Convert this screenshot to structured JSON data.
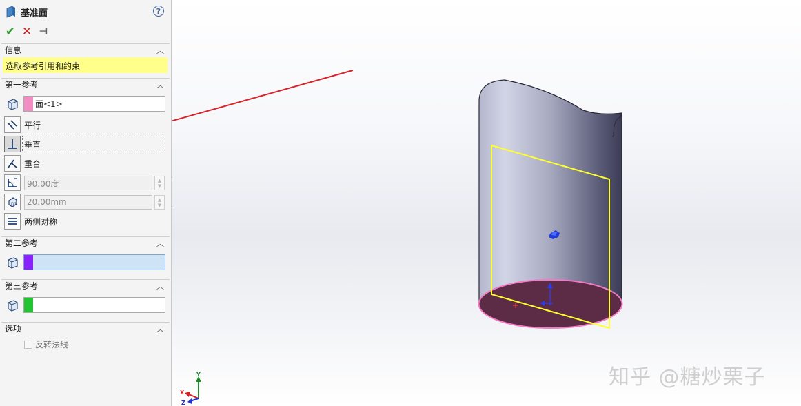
{
  "panel": {
    "title": "基准面",
    "help_glyph": "?",
    "actions": {
      "ok": "✔",
      "cancel": "✕",
      "pin": "⊣"
    },
    "info": {
      "header": "信息",
      "message": "选取参考引用和约束"
    },
    "first_ref": {
      "header": "第一参考",
      "selection": "面<1>",
      "swatch_color": "#f48cc4",
      "constraints": {
        "parallel": "平行",
        "perpendicular": "垂直",
        "coincident": "重合",
        "angle_value": "90.00度",
        "distance_value": "20.00mm",
        "symmetric": "两侧对称"
      }
    },
    "second_ref": {
      "header": "第二参考",
      "selection": "",
      "swatch_color": "#8a22ff"
    },
    "third_ref": {
      "header": "第三参考",
      "selection": "",
      "swatch_color": "#22c433"
    },
    "options": {
      "header": "选项",
      "flip_normal": "反转法线"
    }
  },
  "viewport": {
    "triad": {
      "x": "X",
      "y": "Y",
      "z": "Z"
    },
    "plane_color": "#ffff2a",
    "arrow_color": "#d8232a"
  },
  "watermark": "知乎 @糖炒栗子"
}
